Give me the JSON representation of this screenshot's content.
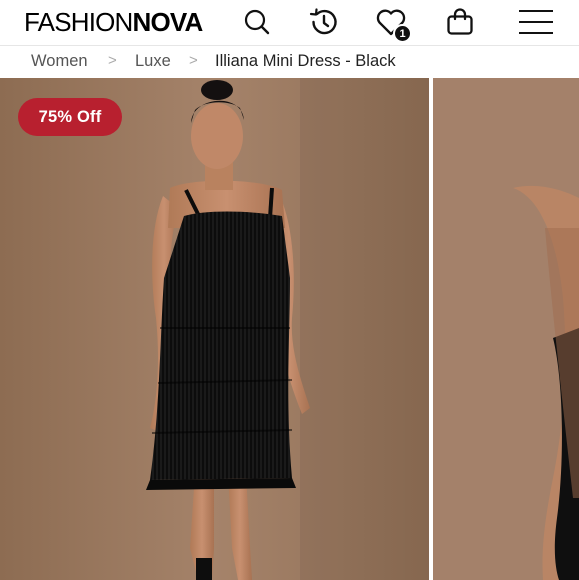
{
  "header": {
    "logo_part1": "FASHION",
    "logo_part2": "NOVA",
    "icons": {
      "search": "search-icon",
      "history": "history-icon",
      "wishlist": "heart-icon",
      "bag": "shopping-bag-icon",
      "menu": "hamburger-menu-icon"
    },
    "wishlist_count": "1"
  },
  "breadcrumb": {
    "items": [
      "Women",
      "Luxe",
      "Illiana Mini Dress - Black"
    ],
    "separator": ">"
  },
  "product": {
    "discount_badge": "75% Off"
  },
  "colors": {
    "badge_red": "#b8202f",
    "photo_background": "#9e7b5f"
  }
}
